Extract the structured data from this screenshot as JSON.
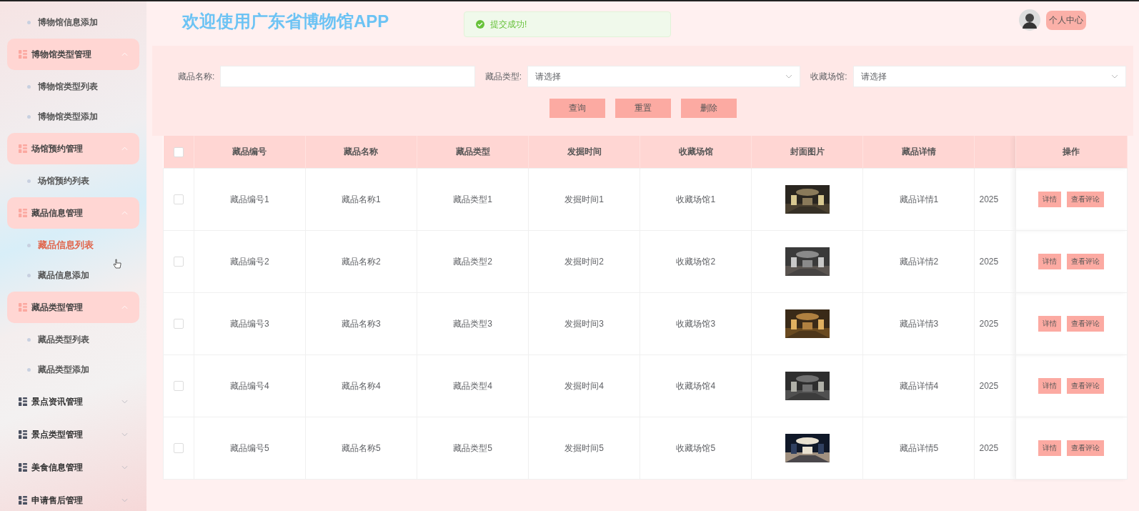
{
  "sidebar": {
    "items": [
      {
        "label": "博物馆信息添加",
        "selected": false
      },
      {
        "label": "博物馆类型管理",
        "expanded": true,
        "children": [
          {
            "label": "博物馆类型列表",
            "selected": false
          },
          {
            "label": "博物馆类型添加",
            "selected": false
          }
        ]
      },
      {
        "label": "场馆预约管理",
        "expanded": true,
        "children": [
          {
            "label": "场馆预约列表",
            "selected": false
          }
        ]
      },
      {
        "label": "藏品信息管理",
        "expanded": true,
        "children": [
          {
            "label": "藏品信息列表",
            "selected": true
          },
          {
            "label": "藏品信息添加",
            "selected": false
          }
        ]
      },
      {
        "label": "藏品类型管理",
        "expanded": true,
        "children": [
          {
            "label": "藏品类型列表",
            "selected": false
          },
          {
            "label": "藏品类型添加",
            "selected": false
          }
        ]
      },
      {
        "label": "景点资讯管理",
        "expanded": false
      },
      {
        "label": "景点类型管理",
        "expanded": false
      },
      {
        "label": "美食信息管理",
        "expanded": false
      },
      {
        "label": "申请售后管理",
        "expanded": false
      }
    ]
  },
  "header": {
    "title": "欢迎使用广东省博物馆APP",
    "toast": "提交成功!",
    "user_button": "个人中心"
  },
  "search": {
    "fields": [
      {
        "label": "藏品名称:",
        "kind": "input"
      },
      {
        "label": "藏品类型:",
        "kind": "select",
        "placeholder": "请选择"
      },
      {
        "label": "收藏场馆:",
        "kind": "select",
        "placeholder": "请选择"
      }
    ],
    "buttons": [
      "查询",
      "重置",
      "删除"
    ]
  },
  "table": {
    "columns": [
      "藏品编号",
      "藏品名称",
      "藏品类型",
      "发掘时间",
      "收藏场馆",
      "封面图片",
      "藏品详情",
      null
    ],
    "action_column": "操作",
    "all_checked": false,
    "rows": [
      {
        "checked": false,
        "cells": [
          "藏品编号1",
          "藏品名称1",
          "藏品类型1",
          "发掘时间1",
          "收藏场馆1",
          {
            "kind": "picture"
          },
          "藏品详情1",
          "2025"
        ],
        "actions": [
          "详情",
          "查看评论"
        ]
      },
      {
        "checked": false,
        "cells": [
          "藏品编号2",
          "藏品名称2",
          "藏品类型2",
          "发掘时间2",
          "收藏场馆2",
          {
            "kind": "picture"
          },
          "藏品详情2",
          "2025"
        ],
        "actions": [
          "详情",
          "查看评论"
        ]
      },
      {
        "checked": false,
        "cells": [
          "藏品编号3",
          "藏品名称3",
          "藏品类型3",
          "发掘时间3",
          "收藏场馆3",
          {
            "kind": "picture"
          },
          "藏品详情3",
          "2025"
        ],
        "actions": [
          "详情",
          "查看评论"
        ]
      },
      {
        "checked": false,
        "cells": [
          "藏品编号4",
          "藏品名称4",
          "藏品类型4",
          "发掘时间4",
          "收藏场馆4",
          {
            "kind": "picture"
          },
          "藏品详情4",
          "2025"
        ],
        "actions": [
          "详情",
          "查看评论"
        ]
      },
      {
        "checked": false,
        "cells": [
          "藏品编号5",
          "藏品名称5",
          "藏品类型5",
          "发掘时间5",
          "收藏场馆5",
          {
            "kind": "picture"
          },
          "藏品详情5",
          "2025"
        ],
        "actions": [
          "详情",
          "查看评论"
        ]
      }
    ]
  }
}
